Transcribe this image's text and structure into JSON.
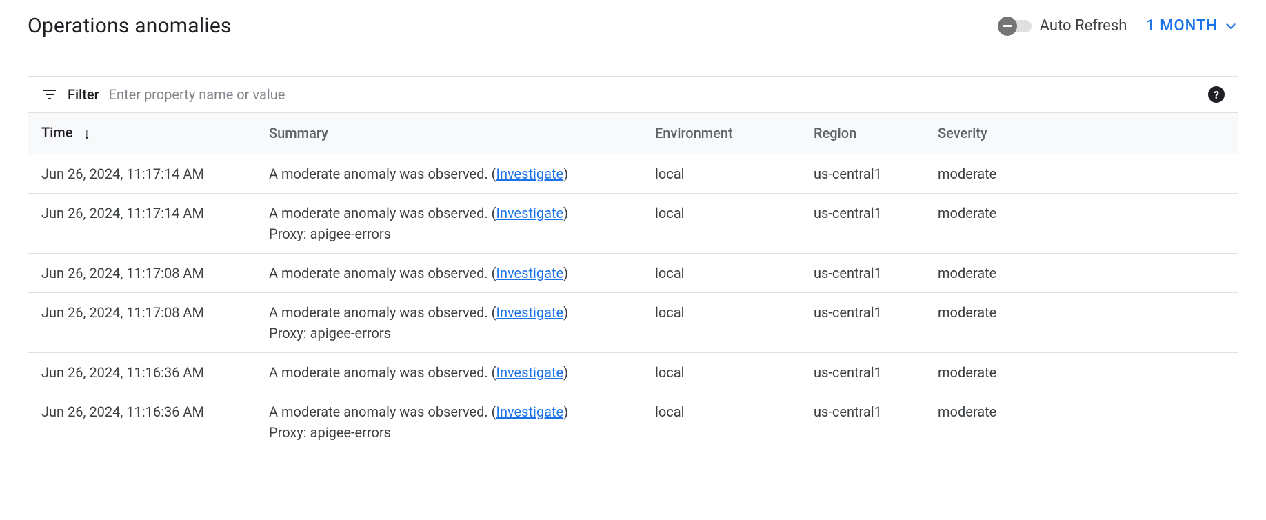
{
  "header": {
    "title": "Operations anomalies",
    "auto_refresh_label": "Auto Refresh",
    "auto_refresh_on": false,
    "time_range_label": "1 MONTH"
  },
  "filter": {
    "label": "Filter",
    "placeholder": "Enter property name or value"
  },
  "table": {
    "columns": {
      "time": "Time",
      "summary": "Summary",
      "environment": "Environment",
      "region": "Region",
      "severity": "Severity"
    },
    "sort": {
      "column": "time",
      "dir": "desc"
    },
    "investigate_label": "Investigate",
    "rows": [
      {
        "time": "Jun 26, 2024, 11:17:14 AM",
        "summary": "A moderate anomaly was observed.",
        "subtext": "",
        "environment": "local",
        "region": "us-central1",
        "severity": "moderate"
      },
      {
        "time": "Jun 26, 2024, 11:17:14 AM",
        "summary": "A moderate anomaly was observed.",
        "subtext": "Proxy: apigee-errors",
        "environment": "local",
        "region": "us-central1",
        "severity": "moderate"
      },
      {
        "time": "Jun 26, 2024, 11:17:08 AM",
        "summary": "A moderate anomaly was observed.",
        "subtext": "",
        "environment": "local",
        "region": "us-central1",
        "severity": "moderate"
      },
      {
        "time": "Jun 26, 2024, 11:17:08 AM",
        "summary": "A moderate anomaly was observed.",
        "subtext": "Proxy: apigee-errors",
        "environment": "local",
        "region": "us-central1",
        "severity": "moderate"
      },
      {
        "time": "Jun 26, 2024, 11:16:36 AM",
        "summary": "A moderate anomaly was observed.",
        "subtext": "",
        "environment": "local",
        "region": "us-central1",
        "severity": "moderate"
      },
      {
        "time": "Jun 26, 2024, 11:16:36 AM",
        "summary": "A moderate anomaly was observed.",
        "subtext": "Proxy: apigee-errors",
        "environment": "local",
        "region": "us-central1",
        "severity": "moderate"
      }
    ]
  }
}
